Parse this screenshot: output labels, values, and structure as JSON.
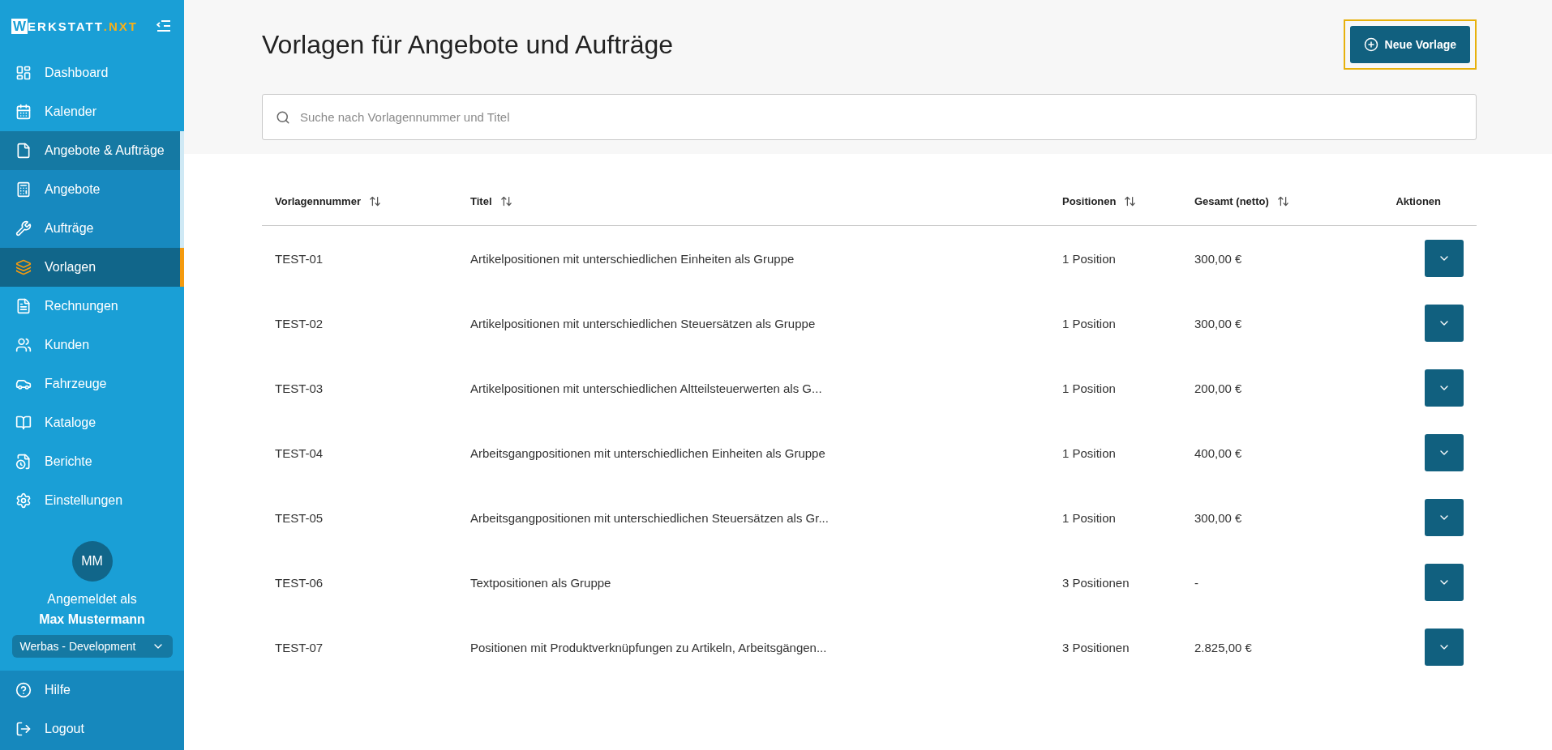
{
  "logo": {
    "boxed": "W",
    "main": "ERKSTATT",
    "accent": ".NXT"
  },
  "sidebar": {
    "items": [
      {
        "label": "Dashboard",
        "selected": false
      },
      {
        "label": "Kalender",
        "selected": false
      },
      {
        "label": "Angebote & Aufträge",
        "selected": false,
        "expanded": true,
        "children": [
          {
            "label": "Angebote",
            "selected": false
          },
          {
            "label": "Aufträge",
            "selected": false
          },
          {
            "label": "Vorlagen",
            "selected": true
          }
        ]
      },
      {
        "label": "Rechnungen",
        "selected": false
      },
      {
        "label": "Kunden",
        "selected": false
      },
      {
        "label": "Fahrzeuge",
        "selected": false
      },
      {
        "label": "Kataloge",
        "selected": false
      },
      {
        "label": "Berichte",
        "selected": false
      },
      {
        "label": "Einstellungen",
        "selected": false
      }
    ],
    "user": {
      "initials": "MM",
      "caption": "Angemeldet als",
      "name": "Max Mustermann",
      "workspace": "Werbas - Development"
    },
    "footer_items": [
      {
        "label": "Hilfe"
      },
      {
        "label": "Logout"
      }
    ]
  },
  "page": {
    "title": "Vorlagen für Angebote und Aufträge",
    "new_button": "Neue Vorlage",
    "search": {
      "placeholder": "Suche nach Vorlagennummer und Titel"
    }
  },
  "table": {
    "columns": [
      {
        "label": "Vorlagennummer"
      },
      {
        "label": "Titel"
      },
      {
        "label": "Positionen"
      },
      {
        "label": "Gesamt (netto)"
      },
      {
        "label": "Aktionen"
      }
    ],
    "rows": [
      {
        "number": "TEST-01",
        "title": "Artikelpositionen mit unterschiedlichen Einheiten als Gruppe",
        "positions": "1 Position",
        "total": "300,00 €"
      },
      {
        "number": "TEST-02",
        "title": "Artikelpositionen mit unterschiedlichen Steuersätzen als Gruppe",
        "positions": "1 Position",
        "total": "300,00 €"
      },
      {
        "number": "TEST-03",
        "title": "Artikelpositionen mit unterschiedlichen Altteilsteuerwerten als G...",
        "positions": "1 Position",
        "total": "200,00 €"
      },
      {
        "number": "TEST-04",
        "title": "Arbeitsgangpositionen mit unterschiedlichen Einheiten als Gruppe",
        "positions": "1 Position",
        "total": "400,00 €"
      },
      {
        "number": "TEST-05",
        "title": "Arbeitsgangpositionen mit unterschiedlichen Steuersätzen als Gr...",
        "positions": "1 Position",
        "total": "300,00 €"
      },
      {
        "number": "TEST-06",
        "title": "Textpositionen als Gruppe",
        "positions": "3 Positionen",
        "total": "-"
      },
      {
        "number": "TEST-07",
        "title": "Positionen mit Produktverknüpfungen zu Artikeln, Arbeitsgängen...",
        "positions": "3 Positionen",
        "total": "2.825,00 €"
      }
    ]
  }
}
